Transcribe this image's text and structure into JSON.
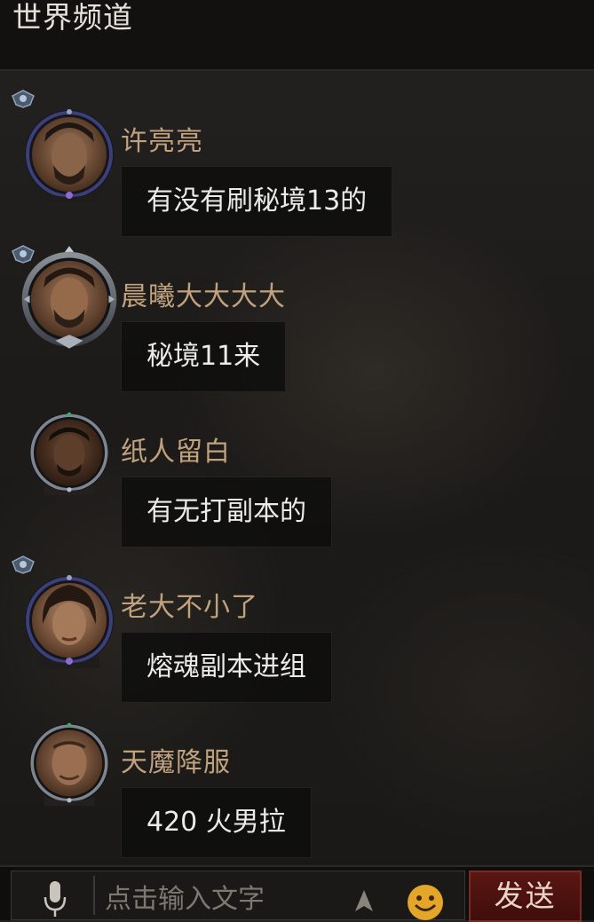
{
  "header": {
    "title": "世界频道"
  },
  "messages": [
    {
      "name": "许亮亮",
      "text": "有没有刷秘境13的",
      "rank_icon": "rank-emblem-icon",
      "avatar_icon": "avatar-portrait-icon"
    },
    {
      "name": "晨曦大大大大",
      "text": "秘境11来",
      "rank_icon": "rank-emblem-icon",
      "avatar_icon": "avatar-portrait-icon"
    },
    {
      "name": "纸人留白",
      "text": "有无打副本的",
      "avatar_icon": "avatar-portrait-icon"
    },
    {
      "name": "老大不小了",
      "text": "熔魂副本进组",
      "rank_icon": "rank-emblem-icon",
      "avatar_icon": "avatar-portrait-icon"
    },
    {
      "name": "天魔降服",
      "text": "420 火男拉",
      "avatar_icon": "avatar-portrait-icon"
    }
  ],
  "input": {
    "placeholder": "点击输入文字",
    "value": ""
  },
  "toolbar": {
    "send_label": "发送",
    "mic_icon": "microphone-icon",
    "arrow_icon": "arrow-up-icon",
    "emoji_icon": "emoji-smiley-icon"
  },
  "colors": {
    "header_bg": "#121110",
    "name": "#c1a27f",
    "bubble_bg": "#0e0d0c",
    "message_text": "#ecebe7",
    "send_button": "#5a1612",
    "emoji": "#e3a62a"
  }
}
